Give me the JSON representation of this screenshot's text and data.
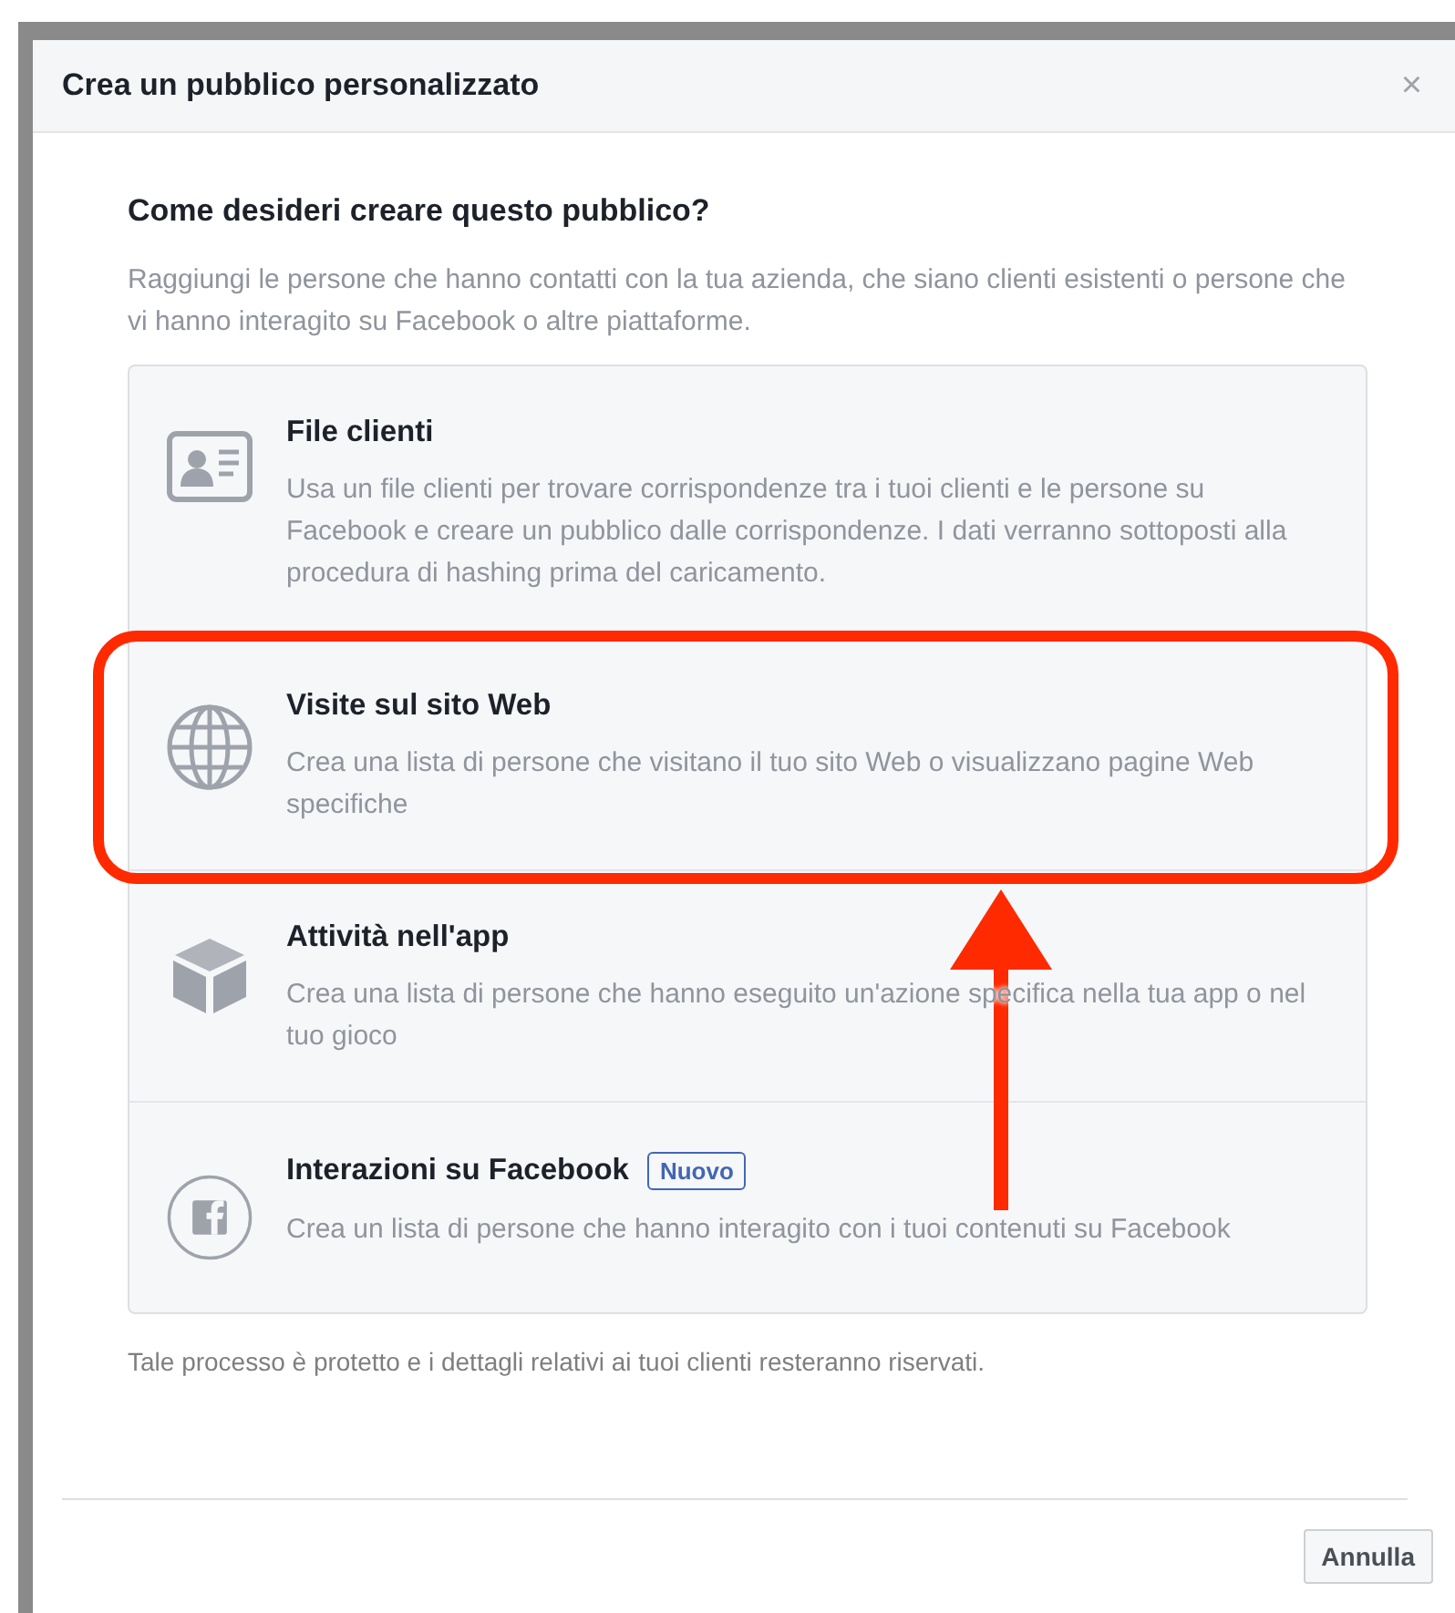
{
  "dialog": {
    "title": "Crea un pubblico personalizzato",
    "close": "×"
  },
  "heading": "Come desideri creare questo pubblico?",
  "intro": "Raggiungi le persone che hanno contatti con la tua azienda, che siano clienti esistenti o persone che vi hanno interagito su Facebook o altre piattaforme.",
  "options": [
    {
      "kind": "customer-file",
      "title": "File clienti",
      "description": "Usa un file clienti per trovare corrispondenze tra i tuoi clienti e le persone su Facebook e creare un pubblico dalle corrispondenze. I dati verranno sottoposti alla procedura di hashing prima del caricamento.",
      "highlighted": false
    },
    {
      "kind": "website",
      "title": "Visite sul sito Web",
      "description": "Crea una lista di persone che visitano il tuo sito Web o visualizzano pagine Web specifiche",
      "highlighted": true
    },
    {
      "kind": "app",
      "title": "Attività nell'app",
      "description": "Crea una lista di persone che hanno eseguito un'azione specifica nella tua app o nel tuo gioco",
      "highlighted": false
    },
    {
      "kind": "engagement",
      "title": "Interazioni su Facebook",
      "badge": "Nuovo",
      "description": "Crea un lista di persone che hanno interagito con i tuoi contenuti su Facebook",
      "highlighted": false
    }
  ],
  "footnote": "Tale processo è protetto e i dettagli relativi ai tuoi clienti resteranno riservati.",
  "buttons": [
    "Annulla"
  ]
}
